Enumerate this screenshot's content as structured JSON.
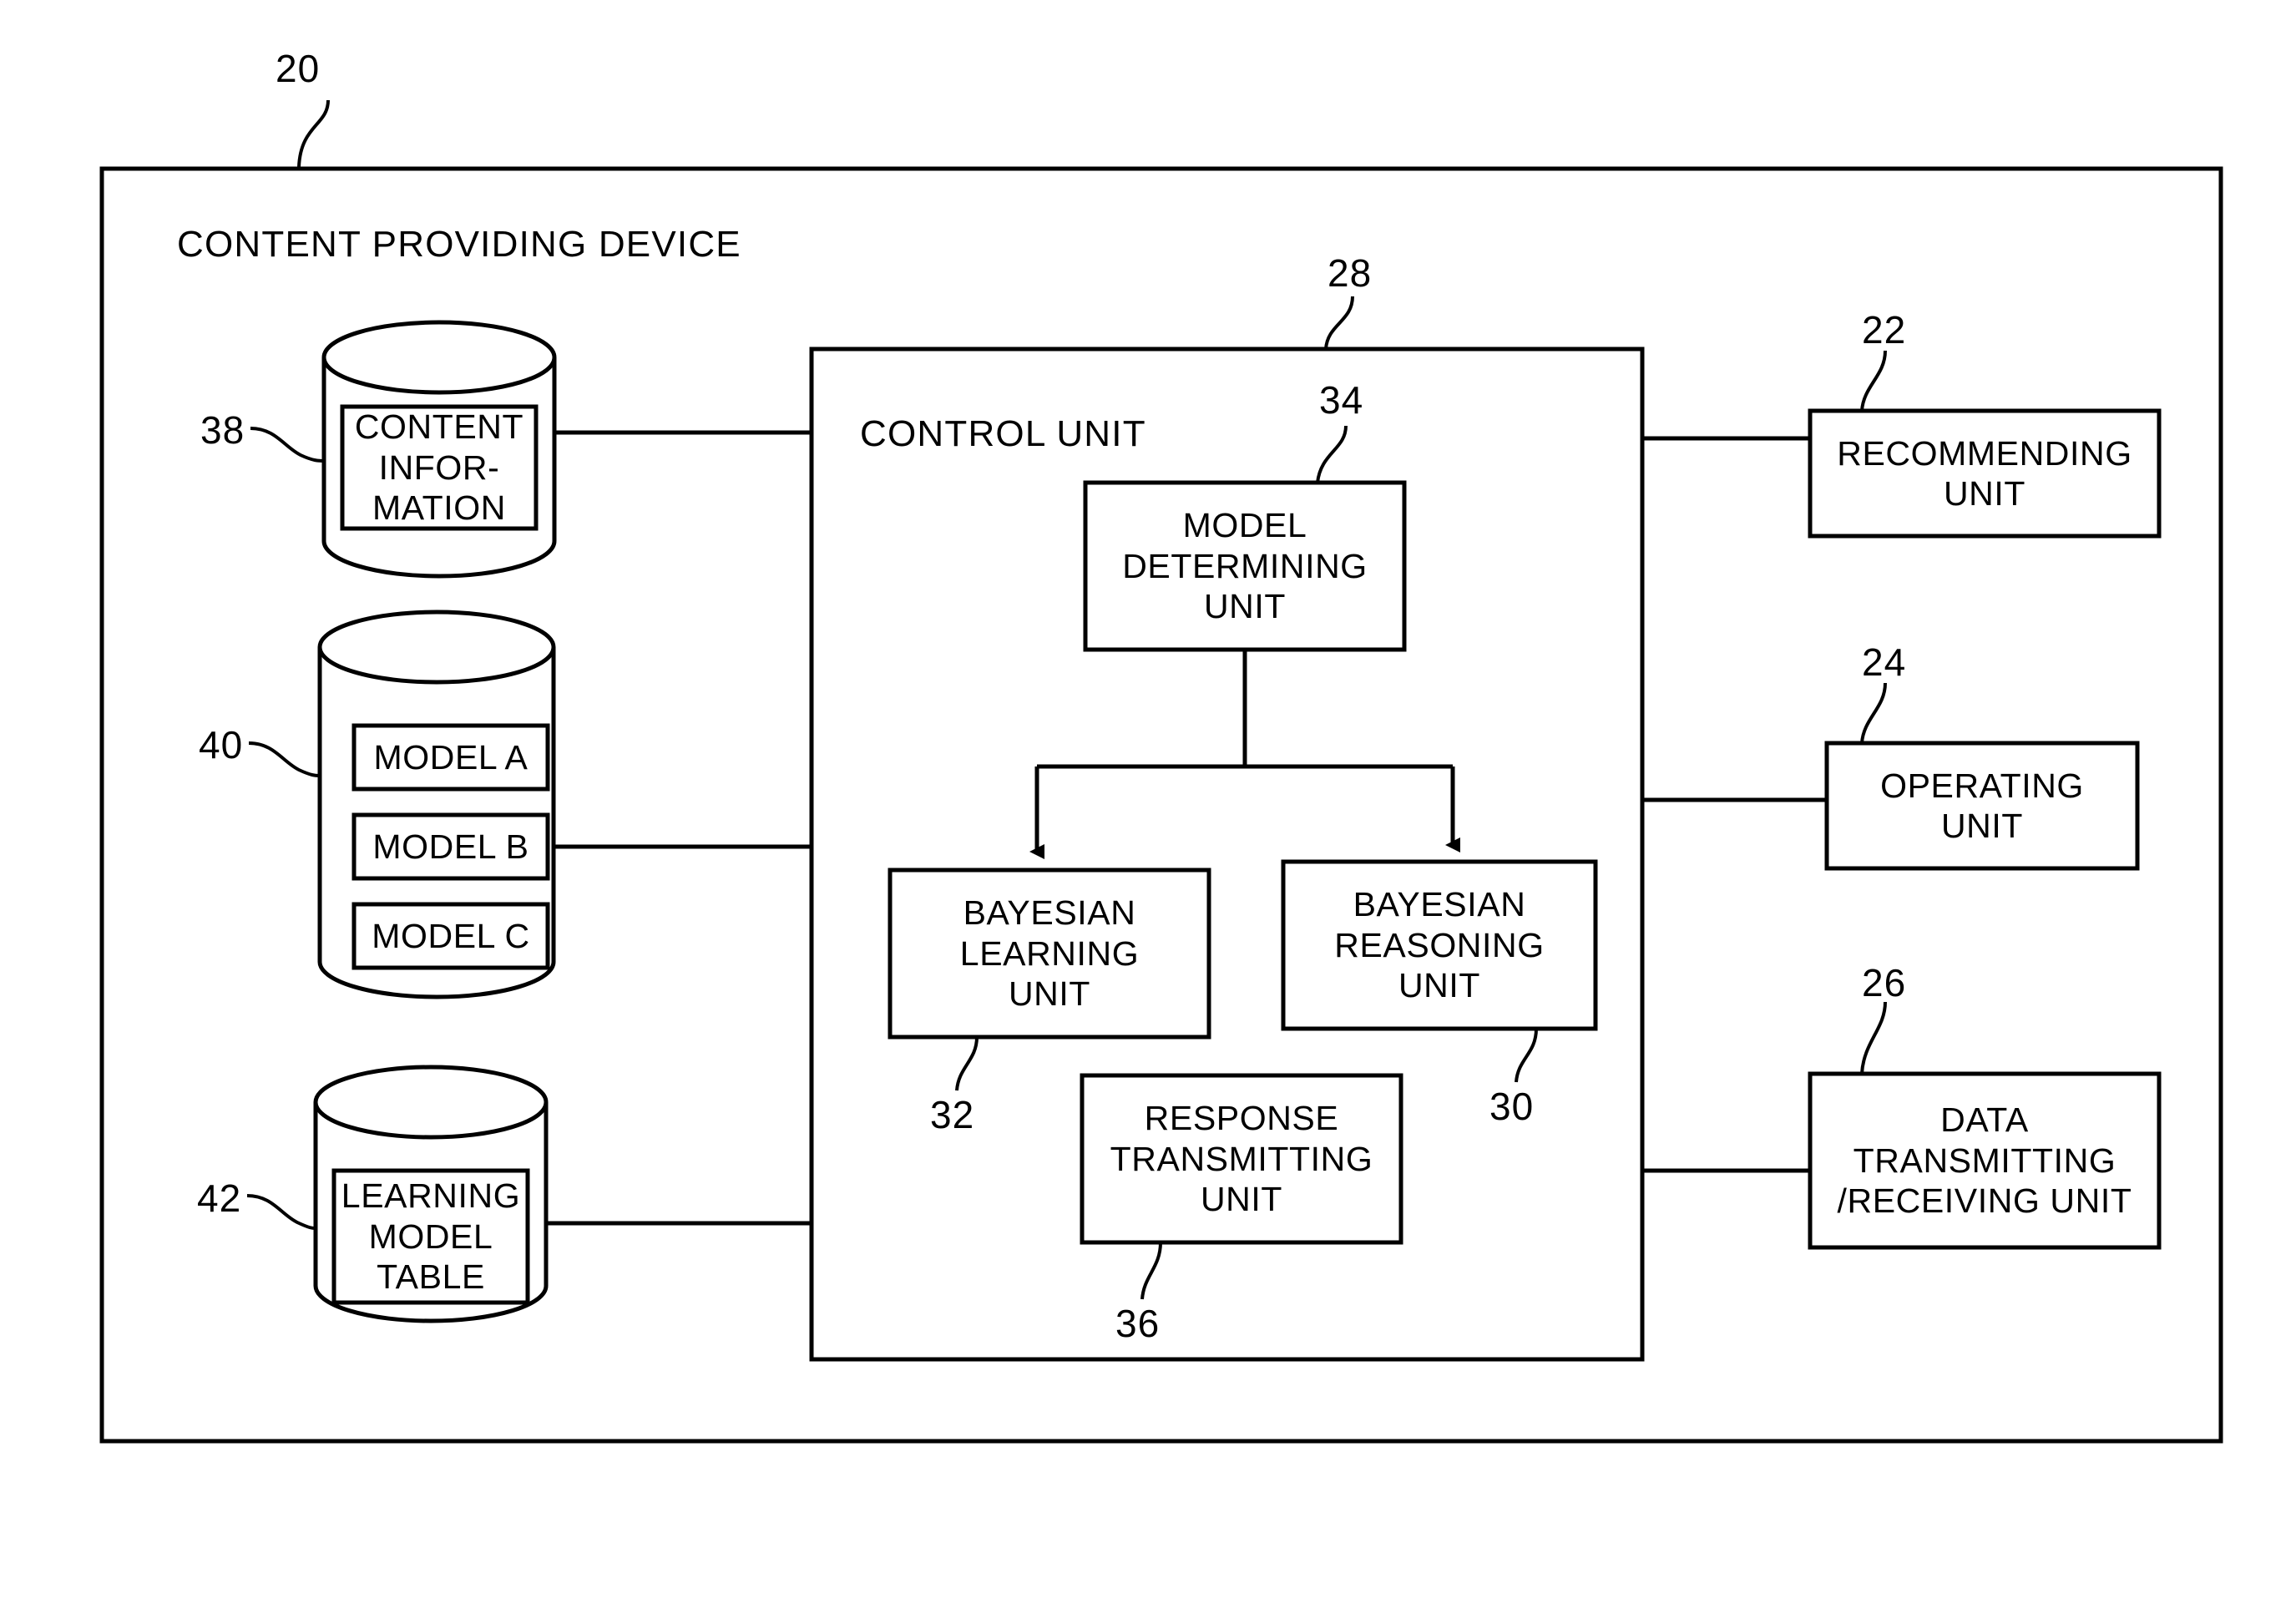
{
  "figure": {
    "type": "patent-block-diagram",
    "device_ref": "20",
    "device_title": "CONTENT PROVIDING DEVICE"
  },
  "control_unit": {
    "ref": "28",
    "title": "CONTROL UNIT",
    "blocks": [
      {
        "id": "model-determining-unit",
        "ref": "34",
        "label": "MODEL\nDETERMINING\nUNIT"
      },
      {
        "id": "bayesian-learning-unit",
        "ref": "32",
        "label": "BAYESIAN\nLEARNING\nUNIT"
      },
      {
        "id": "bayesian-reasoning-unit",
        "ref": "30",
        "label": "BAYESIAN\nREASONING\nUNIT"
      },
      {
        "id": "response-transmitting-unit",
        "ref": "36",
        "label": "RESPONSE\nTRANSMITTING\nUNIT"
      }
    ]
  },
  "storage": [
    {
      "id": "content-information-db",
      "ref": "38",
      "label": "CONTENT\nINFOR-\nMATION",
      "items": []
    },
    {
      "id": "model-db",
      "ref": "40",
      "label": "",
      "items": [
        "MODEL A",
        "MODEL B",
        "MODEL C"
      ]
    },
    {
      "id": "learning-model-table-db",
      "ref": "42",
      "label": "LEARNING\nMODEL\nTABLE",
      "items": []
    }
  ],
  "peripherals": [
    {
      "id": "recommending-unit",
      "ref": "22",
      "label": "RECOMMENDING\nUNIT"
    },
    {
      "id": "operating-unit",
      "ref": "24",
      "label": "OPERATING\nUNIT"
    },
    {
      "id": "data-transmitting-receiving-unit",
      "ref": "26",
      "label": "DATA\nTRANSMITTING\n/RECEIVING UNIT"
    }
  ],
  "colors": {
    "stroke": "#000000",
    "background": "#ffffff"
  }
}
